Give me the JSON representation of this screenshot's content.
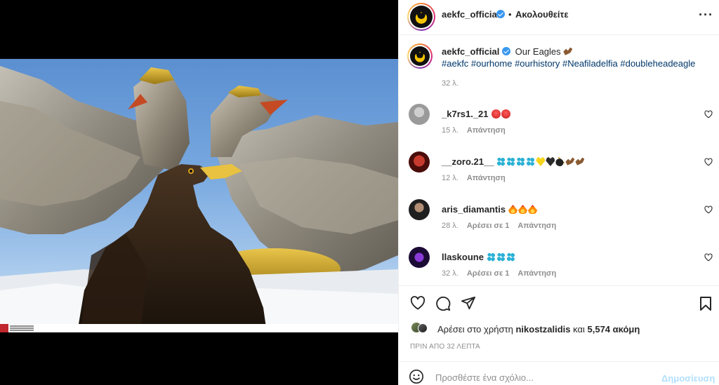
{
  "header": {
    "username": "aekfc_official",
    "separator": "•",
    "follow_label": "Ακολουθείτε",
    "more_label": "···"
  },
  "caption": {
    "username": "aekfc_official",
    "text": "Our Eagles",
    "hashtags": "#aekfc #ourhome #ourhistory #Neafiladelfia #doubleheadeagle",
    "time": "32 λ."
  },
  "comments": [
    {
      "username": "_k7rs1._21",
      "emoji": [
        "angry",
        "angry"
      ],
      "time": "15 λ.",
      "likes": "",
      "reply": "Απάντηση"
    },
    {
      "username": "__zoro.21__",
      "emoji": [
        "paw",
        "paw",
        "paw",
        "paw",
        "yheart",
        "bheart",
        "bomb",
        "eagle",
        "eagle"
      ],
      "time": "12 λ.",
      "likes": "",
      "reply": "Απάντηση"
    },
    {
      "username": "aris_diamantis",
      "emoji": [
        "fire",
        "fire",
        "fire"
      ],
      "time": "28 λ.",
      "likes": "Αρέσει σε 1",
      "reply": "Απάντηση"
    },
    {
      "username": "llaskoune",
      "emoji": [
        "paw",
        "paw",
        "paw"
      ],
      "time": "32 λ.",
      "likes": "Αρέσει σε 1",
      "reply": "Απάντηση"
    }
  ],
  "likes": {
    "prefix": "Αρέσει στο χρήστη",
    "user": "nikostzalidis",
    "and": "και",
    "count": "5,574 ακόμη"
  },
  "posted_ago": "ΠΡΙΝ ΑΠΟ 32 ΛΕΠΤΑ",
  "add_comment": {
    "placeholder": "Προσθέστε ένα σχόλιο...",
    "post_label": "Δημοσίευση"
  },
  "colors": {
    "link": "#00376b",
    "verified": "#3897f0",
    "muted": "#8e8e8e",
    "post_disabled": "#b2dffc"
  },
  "icons": [
    "heart-icon",
    "comment-icon",
    "share-icon",
    "bookmark-icon",
    "smile-icon",
    "verified-icon",
    "more-icon"
  ]
}
